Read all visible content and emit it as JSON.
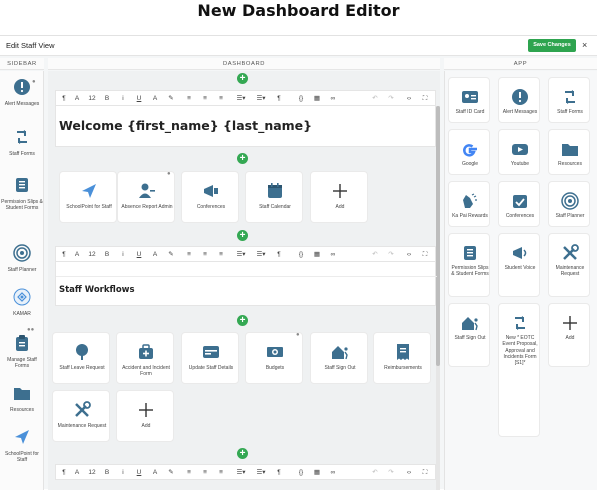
{
  "page_title": "New Dashboard Editor",
  "window": {
    "title": "Edit Staff View",
    "save_label": "Save Changes",
    "close_label": "×"
  },
  "columns": {
    "sidebar": "SIDEBAR",
    "dashboard": "DASHBOARD",
    "app": "APP"
  },
  "sidebar": {
    "items": [
      {
        "label": "Alert Messages",
        "icon": "alert-icon"
      },
      {
        "label": "Staff Forms",
        "icon": "loop-arrows-icon"
      },
      {
        "label": "Permission Slips & Student Forms",
        "icon": "document-list-icon"
      },
      {
        "label": "Staff Planner",
        "icon": "target-icon"
      },
      {
        "label": "KAMAR",
        "icon": "kamar-logo-icon"
      },
      {
        "label": "Manage Staff Forms",
        "icon": "clipboard-icon"
      },
      {
        "label": "Resources",
        "icon": "folder-icon"
      },
      {
        "label": "SchoolPoint for Staff",
        "icon": "send-icon"
      }
    ]
  },
  "toolbar": {
    "paragraph": "¶",
    "font_size": "12",
    "letter": "A",
    "bold": "B",
    "italic": "i",
    "underline": "U",
    "code": "{}"
  },
  "dashboard": {
    "welcome": "Welcome {first_name} {last_name}",
    "quick_tiles": [
      {
        "label": "SchoolPoint for Staff",
        "icon": "send-icon"
      },
      {
        "label": "Absence Report Admin",
        "icon": "person-minus-icon"
      },
      {
        "label": "Conferences",
        "icon": "megaphone-group-icon"
      },
      {
        "label": "Staff Calendar",
        "icon": "calendar-icon"
      },
      {
        "label": "Add",
        "icon": "plus-icon"
      }
    ],
    "workflows_title": "Staff Workflows",
    "workflow_tiles": [
      {
        "label": "Staff Leave Request",
        "icon": "tree-icon"
      },
      {
        "label": "Accident and Incident Form",
        "icon": "medical-kit-icon"
      },
      {
        "label": "Update Staff Details",
        "icon": "id-card-icon"
      },
      {
        "label": "Budgets",
        "icon": "money-icon"
      },
      {
        "label": "Staff Sign Out",
        "icon": "house-run-icon"
      },
      {
        "label": "Reimbursements",
        "icon": "receipt-icon"
      },
      {
        "label": "Maintenance Request",
        "icon": "tools-icon"
      },
      {
        "label": "Add",
        "icon": "plus-icon"
      }
    ]
  },
  "app": {
    "tiles": [
      {
        "label": "Staff ID Card",
        "icon": "id-card-icon"
      },
      {
        "label": "Alert Messages",
        "icon": "alert-icon"
      },
      {
        "label": "Staff Forms",
        "icon": "loop-arrows-icon"
      },
      {
        "label": "Google",
        "icon": "google-icon"
      },
      {
        "label": "Youtube",
        "icon": "youtube-icon"
      },
      {
        "label": "Resources",
        "icon": "folder-icon"
      },
      {
        "label": "Ka Pai Rewards",
        "icon": "clap-hands-icon"
      },
      {
        "label": "Conferences",
        "icon": "check-calendar-icon"
      },
      {
        "label": "Staff Planner",
        "icon": "target-icon"
      },
      {
        "label": "Permission Slips & Student Forms",
        "icon": "document-list-icon"
      },
      {
        "label": "Student Voice",
        "icon": "megaphone-icon"
      },
      {
        "label": "Maintenance Request",
        "icon": "tools-icon"
      },
      {
        "label": "Staff Sign Out",
        "icon": "house-run-icon"
      },
      {
        "label": "New * EOTC Event Proposal, Approval and Incidents Form [S1]*",
        "icon": "loop-arrows-icon"
      },
      {
        "label": "Add",
        "icon": "plus-icon"
      }
    ]
  },
  "colors": {
    "accent": "#2ea44f",
    "icon_blue": "#3d6f8f",
    "light_blue": "#4a90d9",
    "google_blue": "#4285f4"
  }
}
